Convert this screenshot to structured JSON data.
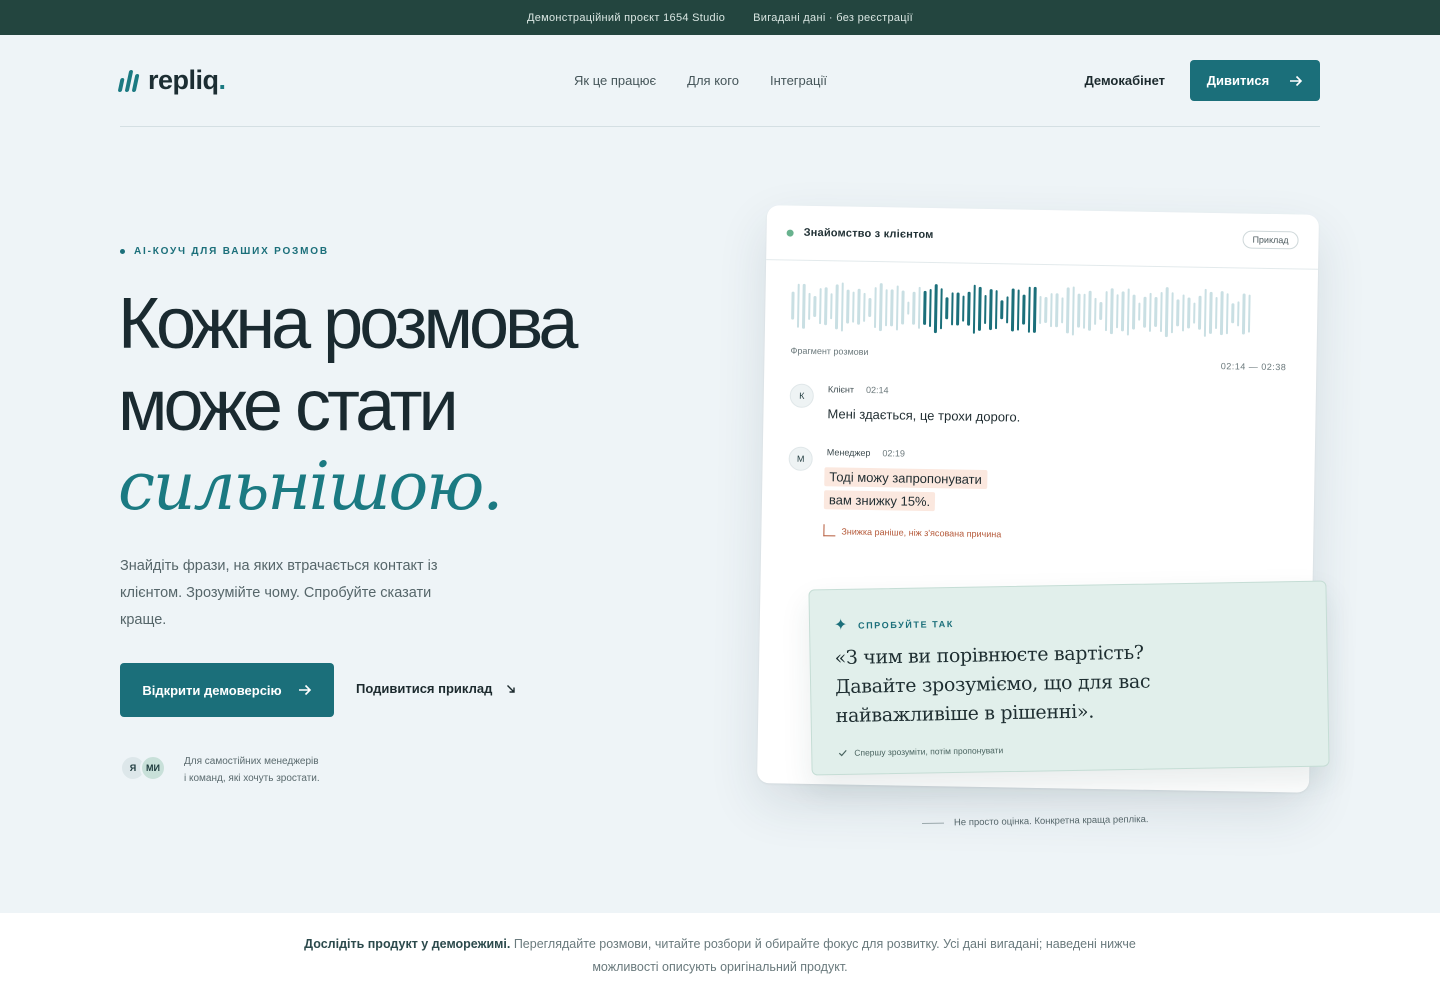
{
  "topbar": {
    "project": "Демонстраційний проєкт 1654 Studio",
    "note": "Вигадані дані · без реєстрації"
  },
  "brand": {
    "name": "repliq",
    "dot": ".",
    "accent": "#1b7a82",
    "dark": "#1b6f7a"
  },
  "nav": {
    "items": [
      "Як це працює",
      "Для кого",
      "Інтеграції"
    ],
    "demo_cabinet": "Демокабінет",
    "watch_button": "Дивитися",
    "watch_icon": "arrow-right-icon"
  },
  "hero": {
    "eyebrow": "AI-КОУЧ ДЛЯ ВАШИХ РОЗМОВ",
    "headline_line1": "Кожна розмова",
    "headline_line2": "може стати",
    "headline_accent": "сильнішою.",
    "subtitle": "Знайдіть фрази, на яких втрачається контакт із клієнтом. Зрозумійте чому. Спробуйте сказати краще.",
    "primary_button": "Відкрити демоверсію",
    "secondary_button": "Подивитися приклад",
    "avatar1": "Я",
    "avatar2": "МИ",
    "audience_line1": "Для самостійних менеджерів",
    "audience_line2": "і команд, які хочуть зростати."
  },
  "card": {
    "title": "Знайомство з клієнтом",
    "badge": "Приклад",
    "fragment_label": "Фрагмент розмови",
    "fragment_time": "02:14 — 02:38",
    "messages": [
      {
        "avatar": "К",
        "role": "Клієнт",
        "time": "02:14",
        "text": "Мені здається, це трохи дорого."
      },
      {
        "avatar": "М",
        "role": "Менеджер",
        "time": "02:19",
        "text_line1": "Тоді можу запропонувати",
        "text_line2": "вам знижку 15%."
      }
    ],
    "issue": "Знижка раніше, ніж з'ясована причина"
  },
  "suggestion": {
    "tag": "СПРОБУЙТЕ ТАК",
    "quote": "«З чим ви порівнюєте вартість? Давайте зрозуміємо, що для вас найважливіше в рішенні».",
    "note": "Спершу зрозуміти, потім пропонувати"
  },
  "caption": "Не просто оцінка. Конкретна краща репліка.",
  "footer": {
    "lead": "Дослідіть продукт у деморежимі.",
    "text": "Переглядайте розмови, читайте розбори й обирайте фокус для розвитку. Усі дані вигадані; наведені нижче можливості описують оригінальний продукт."
  }
}
